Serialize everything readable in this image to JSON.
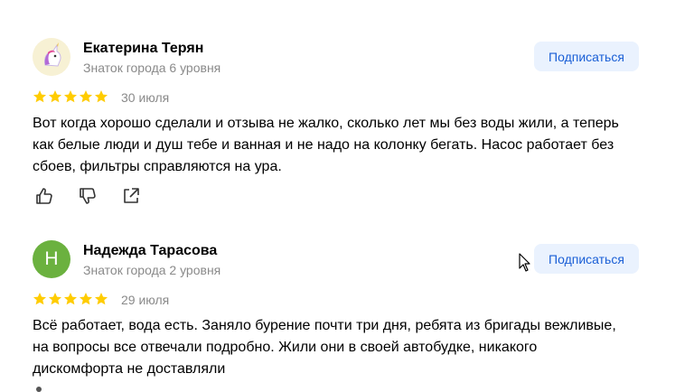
{
  "reviews": [
    {
      "author": "Екатерина Терян",
      "level": "Знаток города 6 уровня",
      "avatar": "unicorn-avatar",
      "subscribe_label": "Подписаться",
      "rating": 5,
      "date": "30 июля",
      "text": "Вот когда хорошо сделали и отзыва не жалко, сколько лет мы без воды жили, а теперь как белые люди и душ тебе и ванная и не надо на колонку бегать. Насос работает без сбоев, фильтры справляются на ура.",
      "actions": [
        "like-icon",
        "dislike-icon",
        "share-icon"
      ]
    },
    {
      "author": "Надежда Тарасова",
      "level": "Знаток города 2 уровня",
      "avatar_letter": "Н",
      "subscribe_label": "Подписаться",
      "rating": 5,
      "date": "29 июля",
      "text": "Всё работает, вода есть. Заняло бурение почти три дня, ребята из бригады вежливые, на вопросы все отвечали подробно. Жили они в своей автобудке, никакого дискомфорта не доставляли"
    }
  ],
  "colors": {
    "star": "#fc0",
    "subscribe_bg": "#eaf2fe",
    "subscribe_text": "#1a5fd6",
    "avatar_green": "#6bb13f",
    "secondary_text": "#8a8a8a"
  }
}
